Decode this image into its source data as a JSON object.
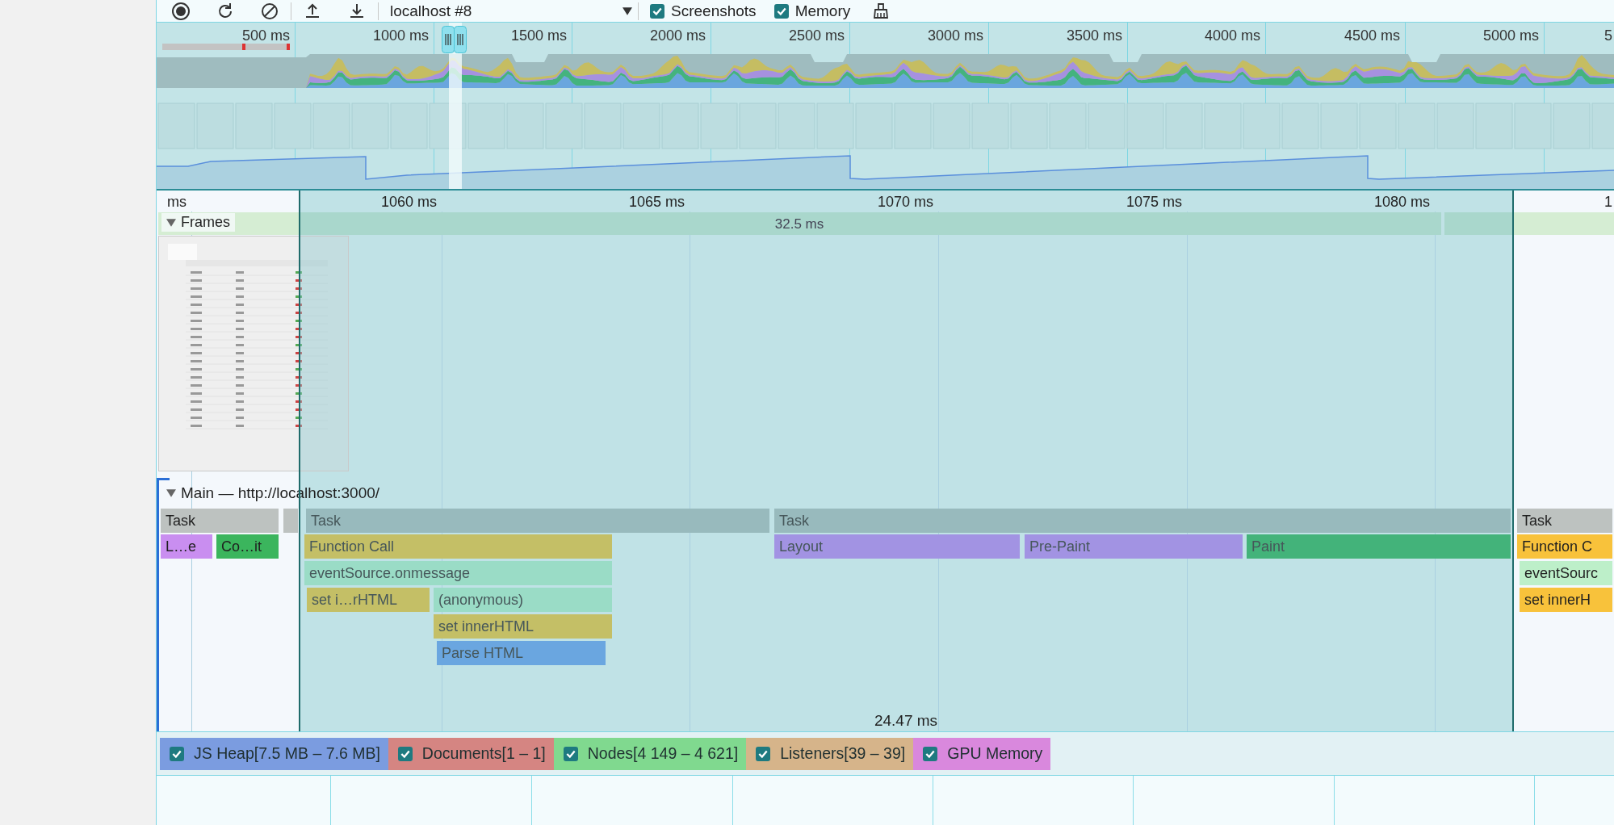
{
  "toolbar": {
    "recording_selector": {
      "value": "localhost #8"
    },
    "checkboxes": [
      {
        "label": "Screenshots",
        "checked": true
      },
      {
        "label": "Memory",
        "checked": true
      }
    ]
  },
  "overview": {
    "ticks": [
      "500 ms",
      "1000 ms",
      "1500 ms",
      "2000 ms",
      "2500 ms",
      "3000 ms",
      "3500 ms",
      "4000 ms",
      "4500 ms",
      "5000 ms",
      "5"
    ]
  },
  "timeline_ruler": {
    "ticks": [
      "ms",
      "1060 ms",
      "1065 ms",
      "1070 ms",
      "1075 ms",
      "1080 ms",
      "1"
    ]
  },
  "frames": {
    "label": "Frames",
    "expanded": true,
    "duration": "32.5 ms"
  },
  "main_track": {
    "title": "Main — http://localhost:3000/",
    "expanded": true,
    "rows": [
      {
        "bars": [
          {
            "name": "Task",
            "color": "#bdc2c0"
          },
          {
            "color": "#bdc2c0"
          },
          {
            "name": "Task",
            "color": "#98babd"
          },
          {
            "name": "Task",
            "color": "#98babd"
          },
          {
            "name": "Task",
            "color": "#bdc2c0"
          }
        ]
      },
      {
        "bars": [
          {
            "name": "L…e",
            "color": "#c98ef0"
          },
          {
            "name": "Co…it",
            "color": "#3bb55d"
          },
          {
            "name": "Function Call",
            "color": "#c4bf66"
          },
          {
            "name": "Layout",
            "color": "#a293e3"
          },
          {
            "name": "Pre-Paint",
            "color": "#a293e3"
          },
          {
            "name": "Paint",
            "color": "#43b37a"
          },
          {
            "name": "Function C",
            "color": "#f8c23b"
          }
        ]
      },
      {
        "bars": [
          {
            "name": "eventSource.onmessage",
            "color": "#9adcc6"
          },
          {
            "name": "eventSourc",
            "color": "#bdefc9"
          }
        ]
      },
      {
        "bars": [
          {
            "name": "set i…rHTML",
            "color": "#c4bf66"
          },
          {
            "name": "(anonymous)",
            "color": "#9adcc6"
          },
          {
            "name": "set innerH",
            "color": "#f8c23b"
          }
        ]
      },
      {
        "bars": [
          {
            "name": "set innerHTML",
            "color": "#c4bf66"
          }
        ]
      },
      {
        "bars": [
          {
            "name": "Parse HTML",
            "color": "#6aa6e0"
          }
        ]
      }
    ]
  },
  "selection": {
    "duration": "24.47 ms"
  },
  "counters": [
    {
      "label": "JS Heap[7.5 MB – 7.6 MB]",
      "checked": true,
      "color": "#7b9ce0"
    },
    {
      "label": "Documents[1 – 1]",
      "checked": true,
      "color": "#d58582"
    },
    {
      "label": "Nodes[4 149 – 4 621]",
      "checked": true,
      "color": "#80d98f"
    },
    {
      "label": "Listeners[39 – 39]",
      "checked": true,
      "color": "#d6b48a"
    },
    {
      "label": "GPU Memory",
      "checked": true,
      "color": "#d988dd"
    }
  ]
}
